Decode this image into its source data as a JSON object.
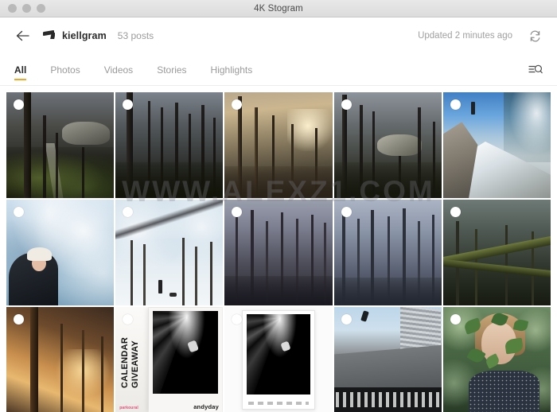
{
  "window": {
    "title": "4K Stogram",
    "traffic_lights": [
      "close",
      "minimize",
      "zoom"
    ]
  },
  "toolbar": {
    "back_icon": "arrow-left-icon",
    "avatar_icon": "profile-avatar",
    "username": "kiellgram",
    "posts_count": "53 posts",
    "updated_text": "Updated 2 minutes ago",
    "refresh_icon": "refresh-icon"
  },
  "tabs": {
    "items": [
      {
        "label": "All",
        "active": true
      },
      {
        "label": "Photos",
        "active": false
      },
      {
        "label": "Videos",
        "active": false
      },
      {
        "label": "Stories",
        "active": false
      },
      {
        "label": "Highlights",
        "active": false
      }
    ],
    "filter_icon": "filter-search-icon",
    "active_color": "#f5a623"
  },
  "watermark": "WWW.ALEXZ1.COM",
  "grid": {
    "columns": 5,
    "selection_marker": "circle-checkbox",
    "items": [
      {
        "id": "r1c1",
        "caption": "Dark mossy forest with boulder and trail"
      },
      {
        "id": "r1c2",
        "caption": "Foggy dark forest trees"
      },
      {
        "id": "r1c3",
        "caption": "Sunlit pine forest at golden hour"
      },
      {
        "id": "r1c4",
        "caption": "Misty forest with large rock"
      },
      {
        "id": "r1c5",
        "caption": "Man standing on snowy cliff"
      },
      {
        "id": "r2c1",
        "caption": "Girl in white beanie in snowy woods"
      },
      {
        "id": "r2c2",
        "caption": "Person walking dog on snowy path"
      },
      {
        "id": "r2c3",
        "caption": "Purple misty forest"
      },
      {
        "id": "r2c4",
        "caption": "Blue foggy tree trunks"
      },
      {
        "id": "r2c5",
        "caption": "Dark mossy fallen logs"
      },
      {
        "id": "r3c1",
        "caption": "Autumn forest at sunset"
      },
      {
        "id": "r3c2",
        "caption": "Calendar giveaway poster"
      },
      {
        "id": "r3c3",
        "caption": "Black and white architecture poster"
      },
      {
        "id": "r3c4",
        "caption": "Jumping man over concrete architecture"
      },
      {
        "id": "r3c5",
        "caption": "Woman holding green leaves"
      }
    ]
  },
  "poster": {
    "calendar_line1": "CALENDAR",
    "calendar_line2": "GIVEAWAY",
    "brand": "andyday",
    "sponsor_logo": "parkoural"
  }
}
